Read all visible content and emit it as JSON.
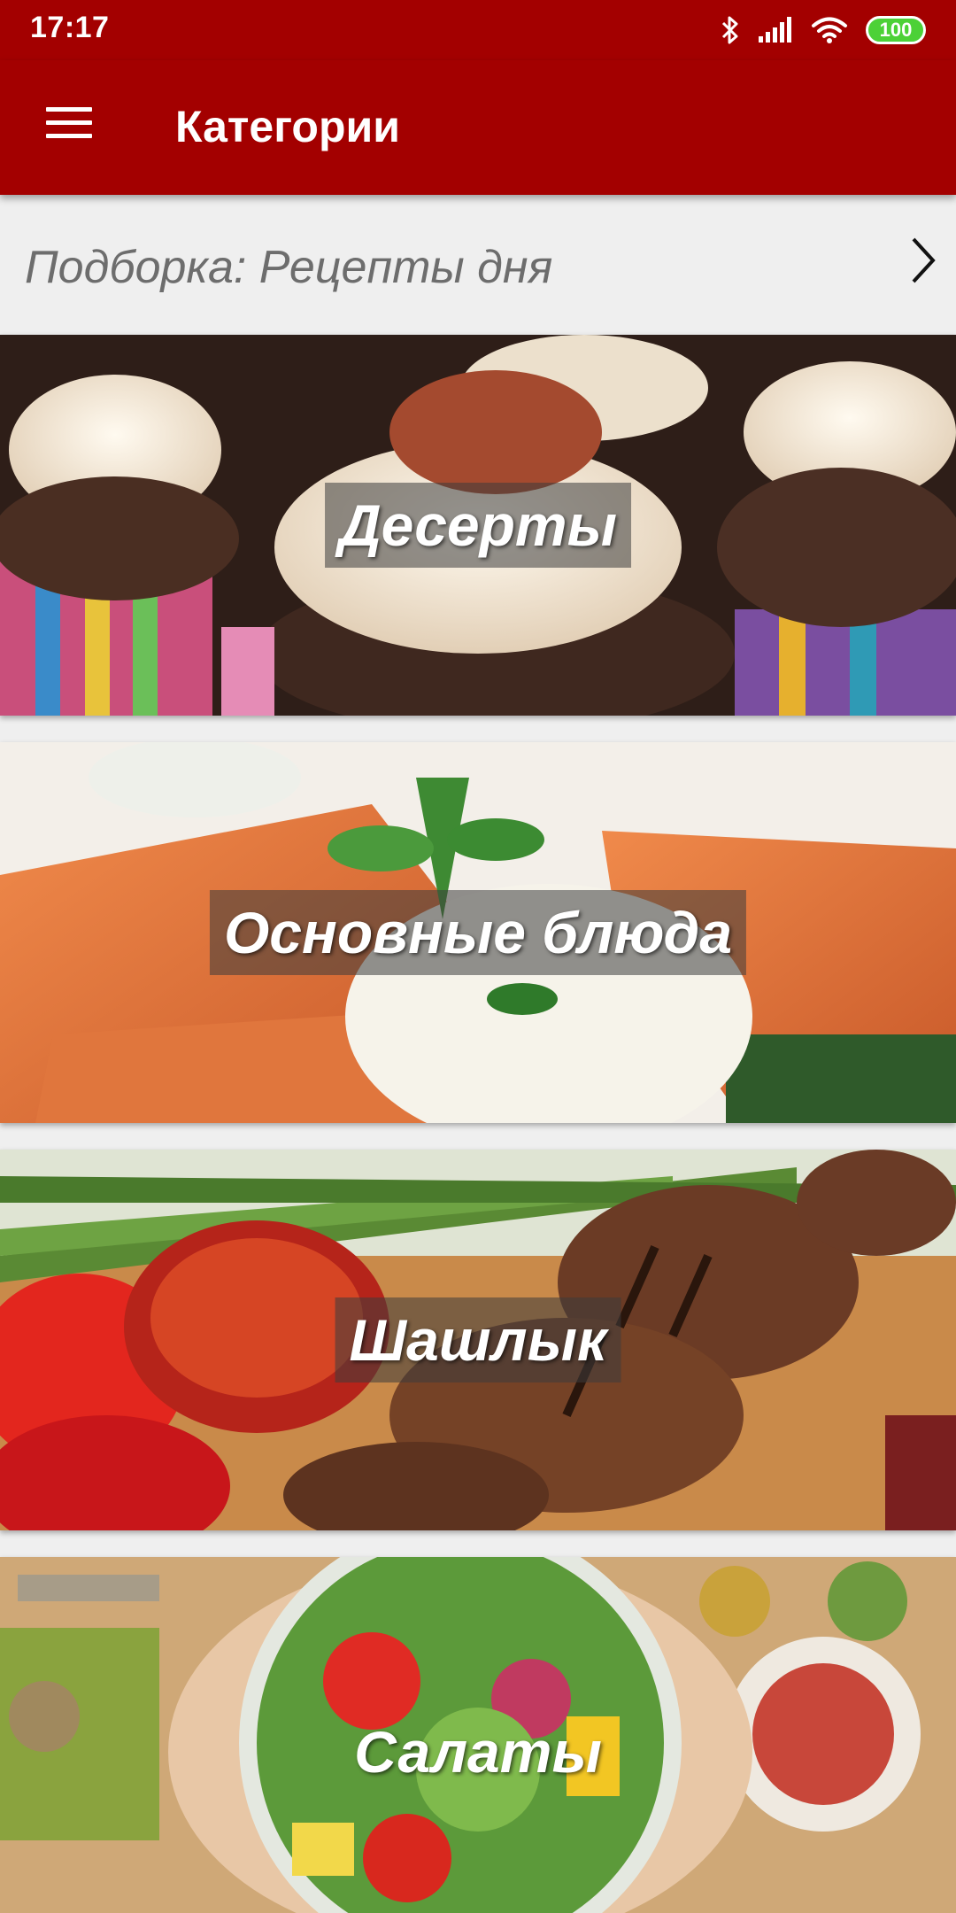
{
  "status_bar": {
    "time": "17:17",
    "battery_level": "100",
    "icons": [
      "bluetooth-icon",
      "signal-icon",
      "wifi-icon",
      "battery-icon"
    ]
  },
  "app_bar": {
    "title": "Категории",
    "menu_icon": "hamburger-menu-icon"
  },
  "selection": {
    "label": "Подборка: Рецепты дня",
    "icon": "chevron-right-icon"
  },
  "categories": [
    {
      "label": "Десерты"
    },
    {
      "label": "Основные блюда"
    },
    {
      "label": "Шашлык"
    },
    {
      "label": "Салаты"
    }
  ],
  "colors": {
    "primary": "#a30000",
    "background": "#efefef",
    "battery": "#4cd137"
  }
}
